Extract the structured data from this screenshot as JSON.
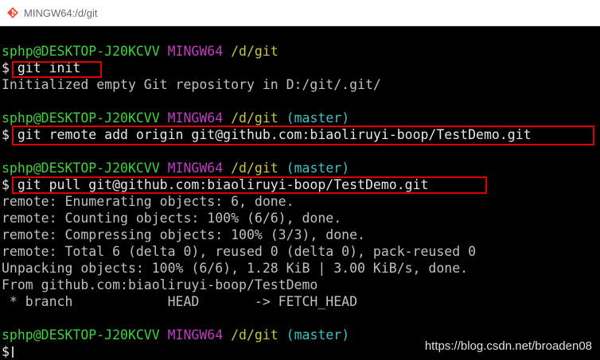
{
  "window": {
    "title": "MINGW64:/d/git",
    "icon": "git-bash-icon"
  },
  "terminal": {
    "prompt_user": "sphp@DESKTOP-J20KCVV",
    "prompt_env": "MINGW64",
    "prompt_dir": "/d/git",
    "branch": "(master)",
    "dollar": "$",
    "cmd_init": "git init",
    "init_output": "Initialized empty Git repository in D:/git/.git/",
    "cmd_remote": "git remote add origin git@github.com:biaoliruyi-boop/TestDemo.git",
    "cmd_pull": "git pull git@github.com:biaoliruyi-boop/TestDemo.git",
    "pull_output": [
      "remote: Enumerating objects: 6, done.",
      "remote: Counting objects: 100% (6/6), done.",
      "remote: Compressing objects: 100% (3/3), done.",
      "remote: Total 6 (delta 0), reused 0 (delta 0), pack-reused 0",
      "Unpacking objects: 100% (6/6), 1.28 KiB | 3.00 KiB/s, done.",
      "From github.com:biaoliruyi-boop/TestDemo",
      " * branch            HEAD       -> FETCH_HEAD"
    ]
  },
  "watermark": "https://blog.csdn.net/broaden08",
  "colors": {
    "user": "#3cd33c",
    "env": "#c03cc0",
    "dir": "#c8c83c",
    "branch": "#3cc3c3",
    "highlight_box": "#e00000"
  }
}
